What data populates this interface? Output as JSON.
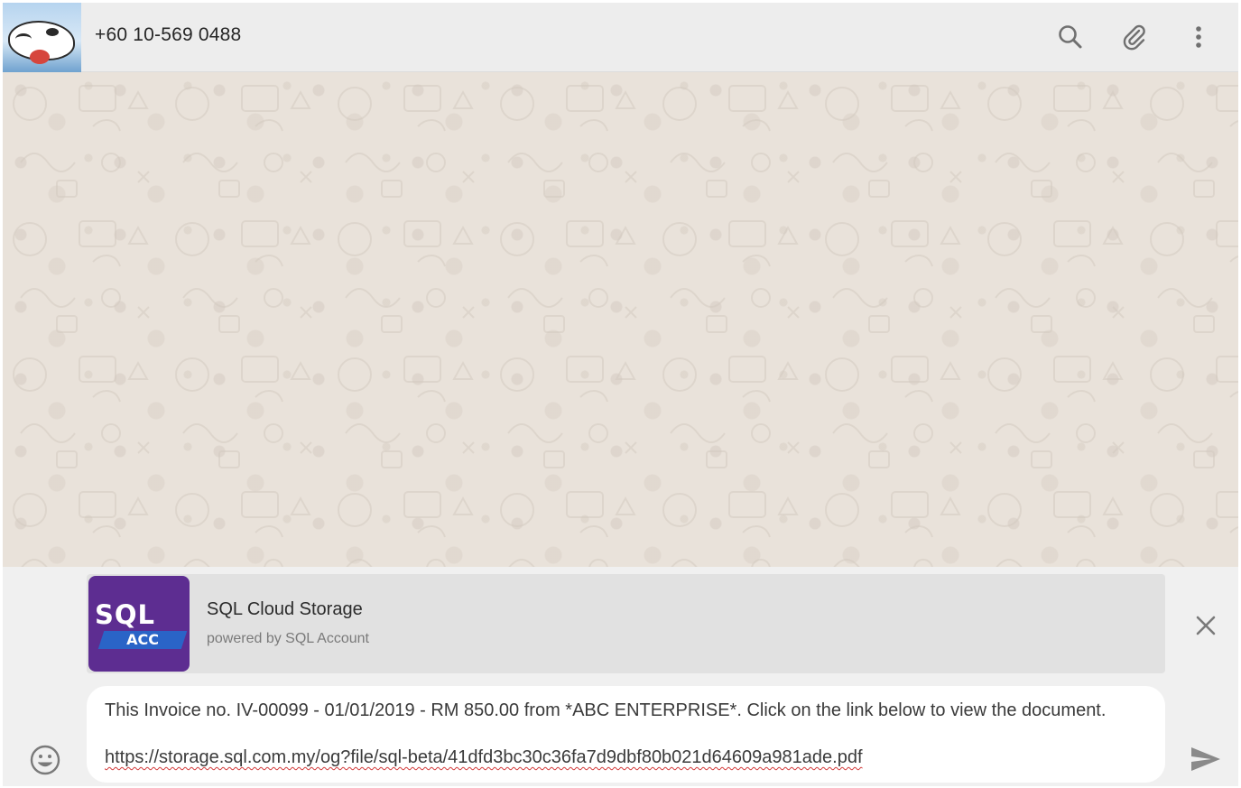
{
  "header": {
    "contact_name": "+60 10-569 0488",
    "icons": [
      "search-icon",
      "paperclip-icon",
      "more-vertical-icon"
    ]
  },
  "preview": {
    "title": "SQL Cloud Storage",
    "subtitle": "powered by SQL Account",
    "logo_text_top": "SQL",
    "logo_text_bottom": "ACC",
    "close_icon": "close-icon"
  },
  "composer": {
    "message_line1": "This Invoice no. IV-00099 - 01/01/2019 - RM 850.00 from *ABC ENTERPRISE*. Click on the link below to view the document.",
    "message_line2": "https://storage.sql.com.my/og?file/sql-beta/41dfd3bc30c36fa7d9dbf80b021d64609a981ade.pdf",
    "emoji_icon": "emoji-icon",
    "send_icon": "send-icon"
  },
  "colors": {
    "header_bg": "#ededed",
    "chat_bg": "#e9e2da",
    "footer_bg": "#f0f0f0",
    "logo_purple": "#5d2d91",
    "logo_blue": "#2a64c7"
  }
}
